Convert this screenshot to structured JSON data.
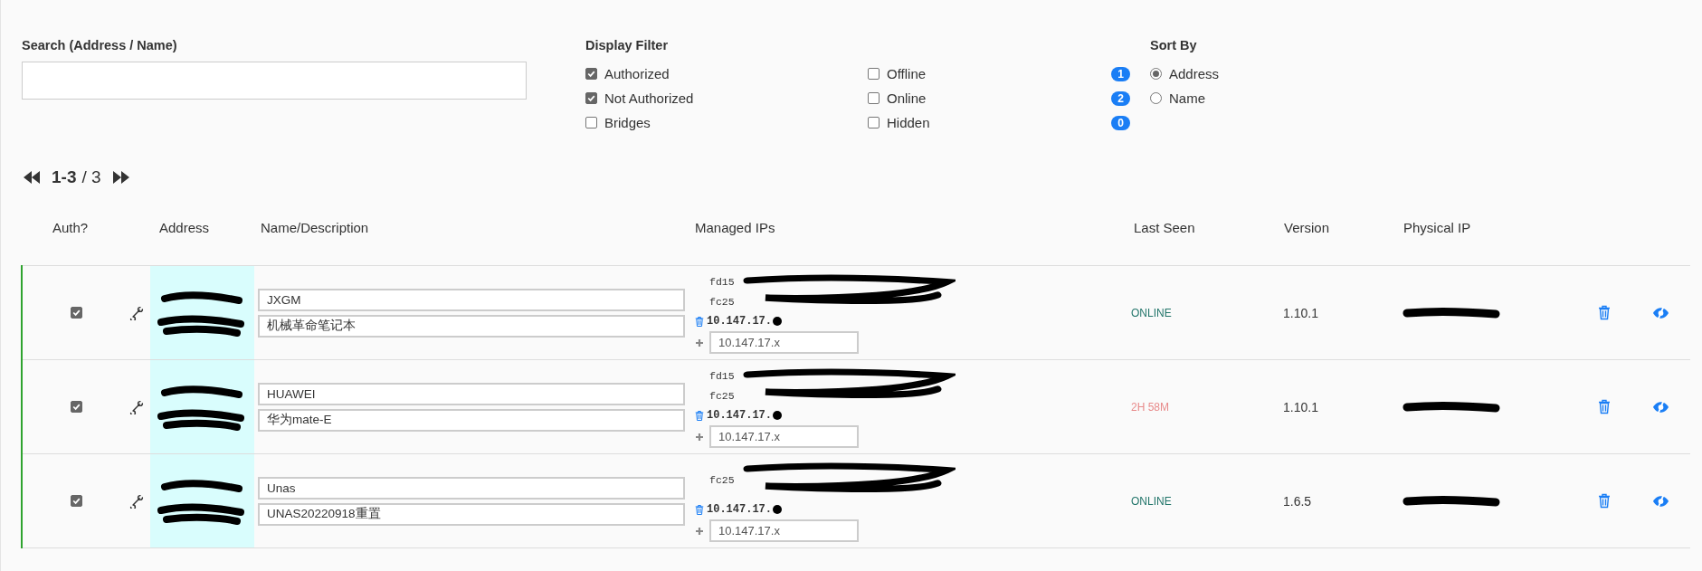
{
  "search": {
    "label": "Search (Address / Name)"
  },
  "display_filter": {
    "title": "Display Filter",
    "options": [
      {
        "label": "Authorized",
        "checked": true
      },
      {
        "label": "Not Authorized",
        "checked": true
      },
      {
        "label": "Bridges",
        "checked": false
      }
    ],
    "status_options": [
      {
        "label": "Offline",
        "checked": false,
        "count": "1"
      },
      {
        "label": "Online",
        "checked": false,
        "count": "2"
      },
      {
        "label": "Hidden",
        "checked": false,
        "count": "0"
      }
    ]
  },
  "sort_by": {
    "title": "Sort By",
    "options": [
      {
        "label": "Address",
        "selected": true
      },
      {
        "label": "Name",
        "selected": false
      }
    ]
  },
  "pager": {
    "range": "1-3",
    "total": "/ 3"
  },
  "table": {
    "columns": [
      "Auth?",
      "Address",
      "Name/Description",
      "Managed IPs",
      "Last Seen",
      "Version",
      "Physical IP"
    ],
    "rows": [
      {
        "authorized": true,
        "name": "JXGM",
        "description": "机械革命笔记本",
        "ipv6": [
          "fd15",
          "fc25"
        ],
        "ipv4": "10.147.17.",
        "new_ip_placeholder": "10.147.17.x",
        "last_seen": "ONLINE",
        "online": true,
        "version": "1.10.1"
      },
      {
        "authorized": true,
        "name": "HUAWEI",
        "description": "华为mate-E",
        "ipv6": [
          "fd15",
          "fc25"
        ],
        "ipv4": "10.147.17.",
        "new_ip_placeholder": "10.147.17.x",
        "last_seen": "2H 58M",
        "online": false,
        "version": "1.10.1"
      },
      {
        "authorized": true,
        "name": "Unas",
        "description": "UNAS20220918重置",
        "ipv6": [
          "fc25"
        ],
        "ipv4": "10.147.17.",
        "new_ip_placeholder": "10.147.17.x",
        "last_seen": "ONLINE",
        "online": true,
        "version": "1.6.5"
      }
    ]
  }
}
